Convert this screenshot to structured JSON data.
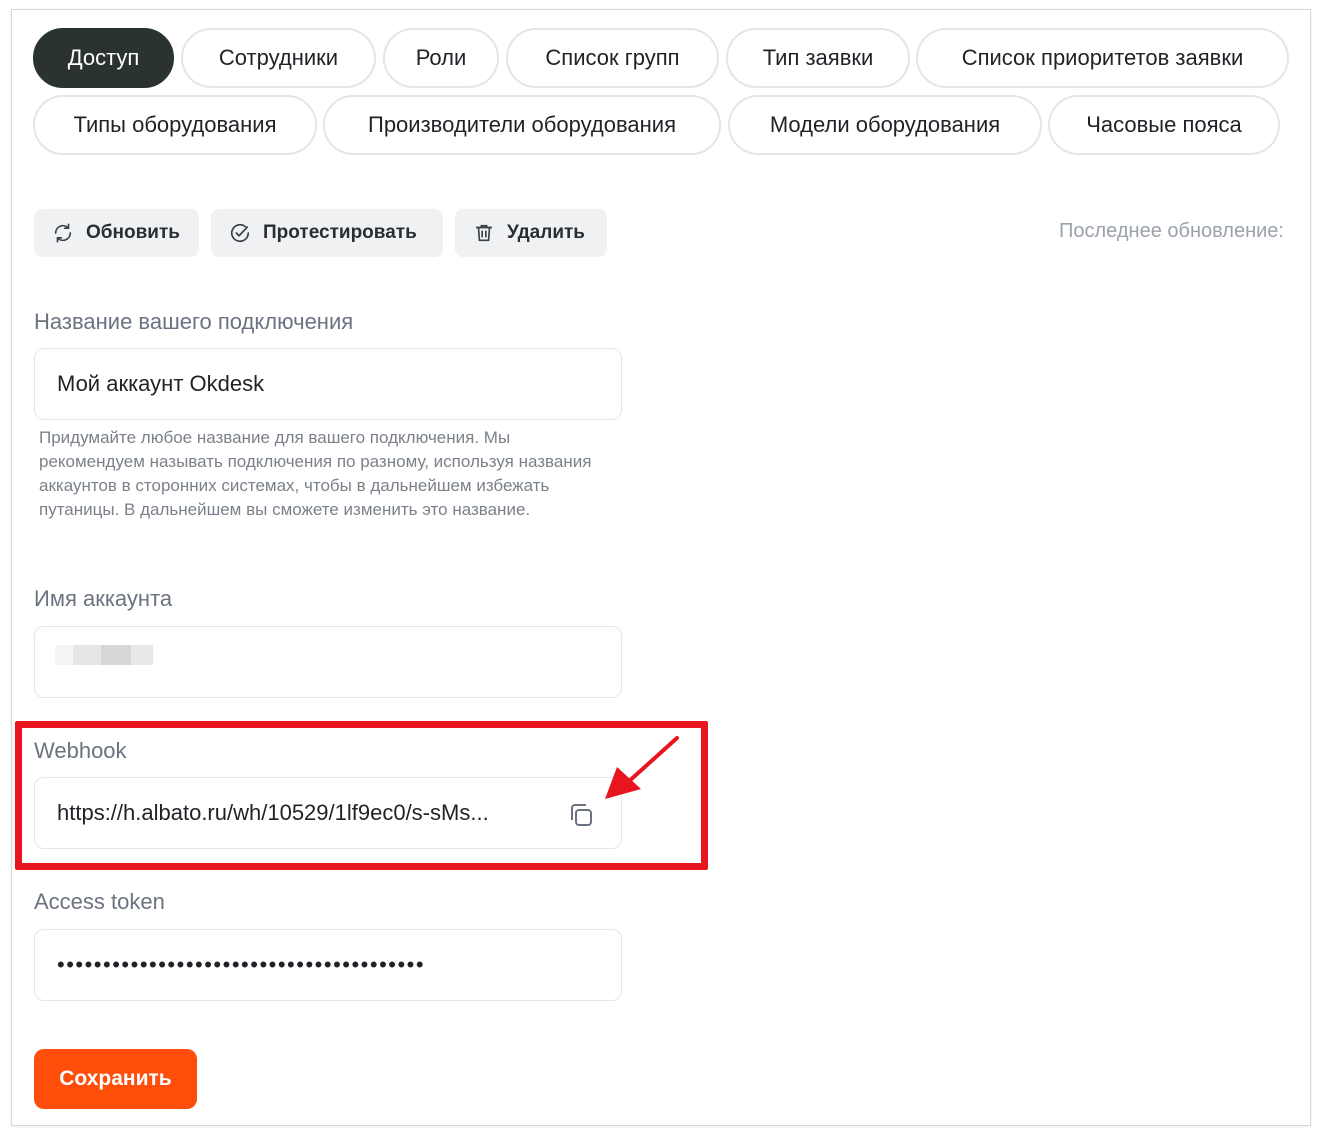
{
  "tabs": [
    {
      "label": "Доступ",
      "active": true
    },
    {
      "label": "Сотрудники",
      "active": false
    },
    {
      "label": "Роли",
      "active": false
    },
    {
      "label": "Список групп",
      "active": false
    },
    {
      "label": "Тип заявки",
      "active": false
    },
    {
      "label": "Список приоритетов заявки",
      "active": false
    },
    {
      "label": "Типы оборудования",
      "active": false
    },
    {
      "label": "Производители оборудования",
      "active": false
    },
    {
      "label": "Модели оборудования",
      "active": false
    },
    {
      "label": "Часовые пояса",
      "active": false
    }
  ],
  "toolbar": {
    "refresh_label": "Обновить",
    "refresh_icon": "refresh-icon",
    "test_label": "Протестировать",
    "test_icon": "check-circle-icon",
    "delete_label": "Удалить",
    "delete_icon": "trash-icon",
    "last_update_label": "Последнее обновление:"
  },
  "connection_name": {
    "label": "Название вашего подключения",
    "value": "Мой аккаунт Okdesk",
    "hint": "Придумайте любое название для вашего подключения. Мы рекомендуем называть подключения по разному, используя названия аккаунтов в сторонних системах, чтобы в дальнейшем избежать путаницы. В дальнейшем вы сможете изменить это название."
  },
  "account_name": {
    "label": "Имя аккаунта",
    "value_redacted": true
  },
  "webhook": {
    "label": "Webhook",
    "value": "https://h.albato.ru/wh/10529/1lf9ec0/s-sMs...",
    "copy_icon": "copy-icon"
  },
  "access_token": {
    "label": "Access token",
    "masked_value": "••••••••••••••••••••••••••••••••••••••••"
  },
  "save_label": "Сохранить",
  "colors": {
    "active_tab_bg": "#2b3232",
    "save_button": "#ff4d0a",
    "highlight": "#e8141e"
  }
}
